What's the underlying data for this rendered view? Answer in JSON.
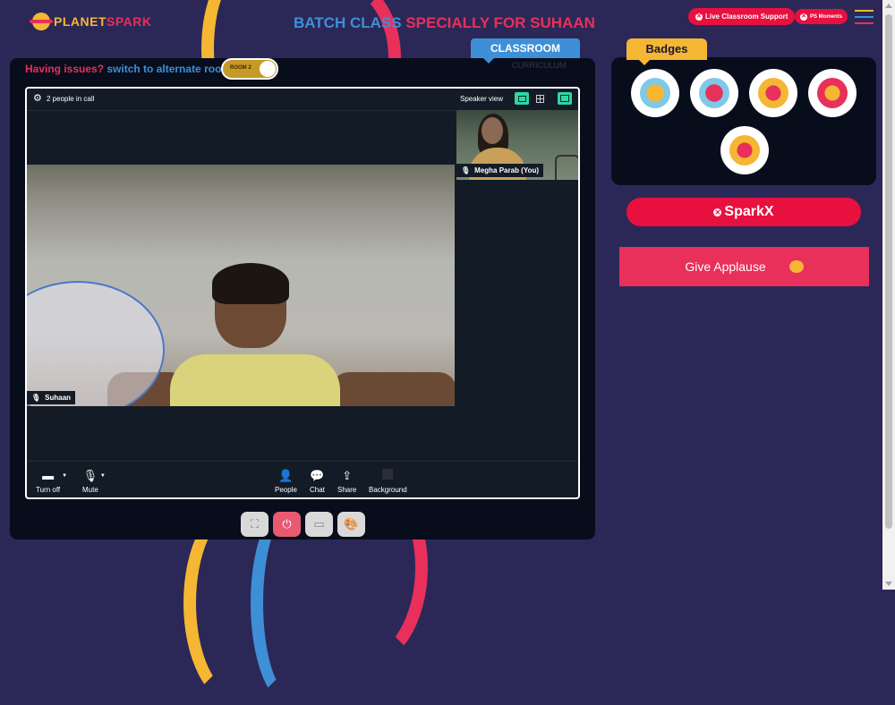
{
  "brand": {
    "logo_part1": "PLANET",
    "logo_part2": "SPARK"
  },
  "header": {
    "title_part1": "BATCH CLASS",
    "title_part2": "SPECIALLY FOR SUHAAN",
    "support_label": "Live Classroom Support",
    "moments_label": "PS Moments"
  },
  "tabs": {
    "classroom": "CLASSROOM",
    "curriculum": "CURRICULUM"
  },
  "issues": {
    "part1": "Having issues?",
    "part2": "switch to alternate room",
    "room_label": "ROOM 2"
  },
  "call": {
    "people_count": "2 people in call",
    "view_label": "Speaker view",
    "participants": [
      {
        "name": "Suhaan"
      },
      {
        "name": "Megha Parab (You)"
      }
    ],
    "controls": [
      {
        "label": "Turn off",
        "icon": "camera-icon"
      },
      {
        "label": "Mute",
        "icon": "microphone-icon"
      },
      {
        "label": "People",
        "icon": "people-icon"
      },
      {
        "label": "Chat",
        "icon": "chat-icon"
      },
      {
        "label": "Share",
        "icon": "share-icon"
      },
      {
        "label": "Background",
        "icon": "background-icon"
      }
    ]
  },
  "bottom_buttons": [
    {
      "icon": "fullscreen-icon"
    },
    {
      "icon": "power-icon"
    },
    {
      "icon": "screen-icon"
    },
    {
      "icon": "palette-icon"
    }
  ],
  "badges": {
    "title": "Badges",
    "items": [
      {
        "icon": "trophy-badge-icon"
      },
      {
        "icon": "hero-badge-icon"
      },
      {
        "icon": "rocket-badge-icon"
      },
      {
        "icon": "idea-badge-icon"
      },
      {
        "icon": "robot-badge-icon"
      }
    ]
  },
  "sparkx_label": "SparkX",
  "applause_label": "Give Applause",
  "colors": {
    "background": "#2b2858",
    "accent_red": "#e8103f",
    "accent_blue": "#3f8fd6",
    "accent_yellow": "#f5b733",
    "panel": "#080d1c",
    "video_bg": "#131c26",
    "active_toggle": "#2ed6a5"
  }
}
